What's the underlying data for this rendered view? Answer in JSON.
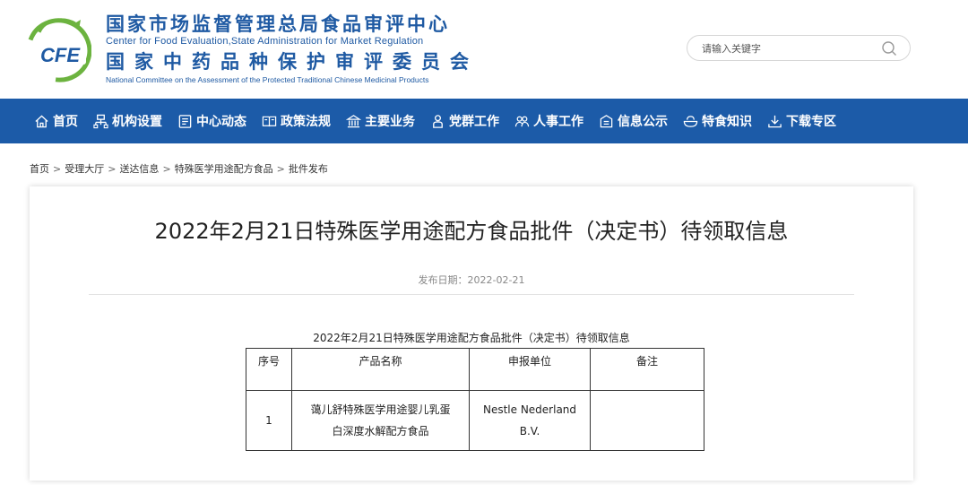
{
  "header": {
    "org_name_cn": "国家市场监督管理总局食品审评中心",
    "org_name_en": "Center for Food Evaluation,State Administration for Market Regulation",
    "committee_cn": "国家中药品种保护审评委员会",
    "committee_en": "National Committee on the Assessment of the Protected Traditional Chinese Medicinal Products",
    "logo_text": "CFE",
    "search": {
      "placeholder": "请输入关键字",
      "icon": "search-icon"
    }
  },
  "nav": {
    "items": [
      {
        "label": "首页",
        "icon": "home-icon"
      },
      {
        "label": "机构设置",
        "icon": "org-chart-icon"
      },
      {
        "label": "中心动态",
        "icon": "news-icon"
      },
      {
        "label": "政策法规",
        "icon": "law-icon"
      },
      {
        "label": "主要业务",
        "icon": "bank-icon"
      },
      {
        "label": "党群工作",
        "icon": "person-icon"
      },
      {
        "label": "人事工作",
        "icon": "people-icon"
      },
      {
        "label": "信息公示",
        "icon": "notice-icon"
      },
      {
        "label": "特食知识",
        "icon": "food-icon"
      },
      {
        "label": "下载专区",
        "icon": "download-icon"
      }
    ]
  },
  "breadcrumb": [
    "首页",
    "受理大厅",
    "送达信息",
    "特殊医学用途配方食品",
    "批件发布"
  ],
  "breadcrumb_separator": ">",
  "article": {
    "title": "2022年2月21日特殊医学用途配方食品批件（决定书）待领取信息",
    "publish_date": "发布日期：2022-02-21",
    "table_caption": "2022年2月21日特殊医学用途配方食品批件（决定书）待领取信息",
    "table": {
      "headers": [
        "序号",
        "产品名称",
        "申报单位",
        "备注"
      ],
      "rows": [
        {
          "seq": "1",
          "name_line1": "蔼儿舒特殊医学用途婴儿乳蛋",
          "name_line2": "白深度水解配方食品",
          "unit_line1": "Nestle Nederland",
          "unit_line2": "B.V.",
          "note": ""
        }
      ]
    }
  },
  "colors": {
    "brand_blue": "#1c5ba8",
    "logo_green": "#6cb33f",
    "text_blue": "#1f5aa3"
  }
}
